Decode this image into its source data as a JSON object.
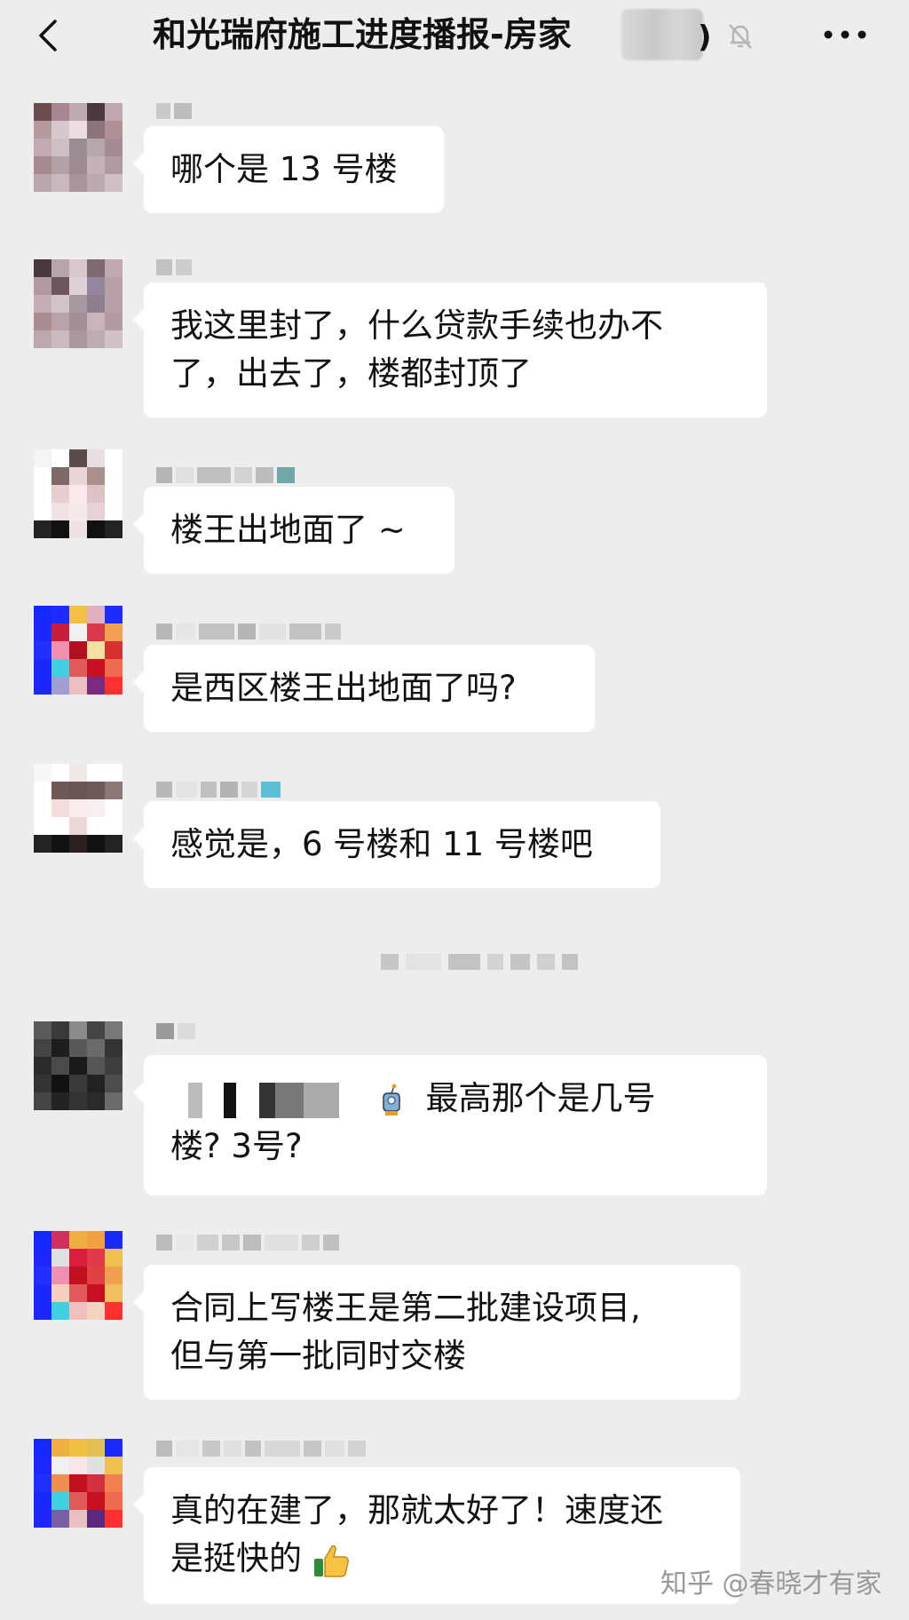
{
  "header": {
    "title": "和光瑞府施工进度播报-房家",
    "title_suffix": ")"
  },
  "messages": [
    {
      "text_lines": [
        "哪个是 13 号楼"
      ]
    },
    {
      "text_lines": [
        "我这里封了，什么贷款手续也办不",
        "了，出去了，楼都封顶了"
      ]
    },
    {
      "text_lines": [
        "楼王出地面了 ~"
      ]
    },
    {
      "text_lines": [
        "是西区楼王出地面了吗?"
      ]
    },
    {
      "text_lines": [
        "感觉是，6 号楼和 11 号楼吧"
      ]
    },
    {
      "text_main": "最高那个是几号",
      "text_line2": "楼?  3号?"
    },
    {
      "text_lines": [
        "合同上写楼王是第二批建设项目,",
        "但与第一批同时交楼"
      ]
    },
    {
      "text_line1": "真的在建了，那就太好了！速度还",
      "text_line2": "是挺快的"
    }
  ],
  "watermark": "知乎 @春晓才有家",
  "colors": {
    "background": "#ededed",
    "bubble": "#ffffff",
    "text": "#111111"
  },
  "icons": {
    "back": "chevron-left-icon",
    "mute": "bell-muted-icon",
    "more": "ellipsis-icon",
    "robot": "robot-icon",
    "thumb": "thumbs-up-icon"
  }
}
